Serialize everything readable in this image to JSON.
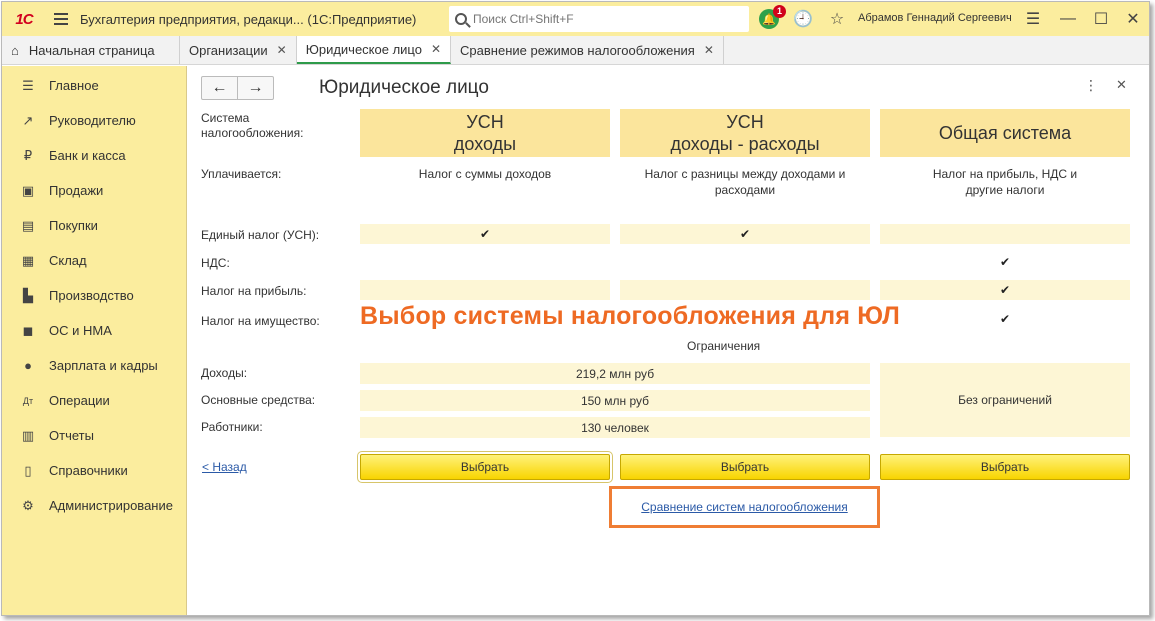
{
  "titlebar": {
    "logo": "1С",
    "app_title": "Бухгалтерия предприятия, редакци...  (1С:Предприятие)",
    "search_placeholder": "Поиск Ctrl+Shift+F",
    "notifications_count": "1",
    "user_name": "Абрамов Геннадий Сергеевич"
  },
  "tabs": [
    {
      "label": "Начальная страница"
    },
    {
      "label": "Организации"
    },
    {
      "label": "Юридическое лицо"
    },
    {
      "label": "Сравнение режимов налогообложения"
    }
  ],
  "sidebar": {
    "items": [
      {
        "label": "Главное",
        "icon": "menu-icon"
      },
      {
        "label": "Руководителю",
        "icon": "trend-icon"
      },
      {
        "label": "Банк и касса",
        "icon": "ruble-icon"
      },
      {
        "label": "Продажи",
        "icon": "bag-icon"
      },
      {
        "label": "Покупки",
        "icon": "cart-icon"
      },
      {
        "label": "Склад",
        "icon": "warehouse-icon"
      },
      {
        "label": "Производство",
        "icon": "factory-icon"
      },
      {
        "label": "ОС и НМА",
        "icon": "truck-icon"
      },
      {
        "label": "Зарплата и кадры",
        "icon": "people-icon"
      },
      {
        "label": "Операции",
        "icon": "dt-kt-icon"
      },
      {
        "label": "Отчеты",
        "icon": "report-icon"
      },
      {
        "label": "Справочники",
        "icon": "book-icon"
      },
      {
        "label": "Администрирование",
        "icon": "gear-icon"
      }
    ]
  },
  "form": {
    "title": "Юридическое лицо",
    "labels": {
      "tax_system": "Система налогообложения:",
      "paid": "Уплачивается:",
      "single_tax": "Единый налог (УСН):",
      "vat": "НДС:",
      "profit_tax": "Налог на прибыль:",
      "property_tax": "Налог на имущество:",
      "income": "Доходы:",
      "fixed_assets": "Основные средства:",
      "employees": "Работники:"
    },
    "columns": [
      {
        "line1": "УСН",
        "line2": "доходы",
        "desc": "Налог с суммы доходов"
      },
      {
        "line1": "УСН",
        "line2": "доходы - расходы",
        "desc": "Налог с разницы между доходами и расходами"
      },
      {
        "line1": "Общая система",
        "line2": "",
        "desc": "Налог на прибыль, НДС и другие налоги"
      }
    ],
    "check_mark": "✔",
    "restrictions_title": "Ограничения",
    "limits": {
      "income": "219,2 млн руб",
      "fixed_assets": "150 млн руб",
      "employees": "130 человек",
      "general": "Без ограничений"
    },
    "select_label": "Выбрать",
    "back_link": "< Назад",
    "compare_link": "Сравнение систем налогообложения"
  },
  "overlay_heading": "Выбор системы налогообложения для ЮЛ"
}
